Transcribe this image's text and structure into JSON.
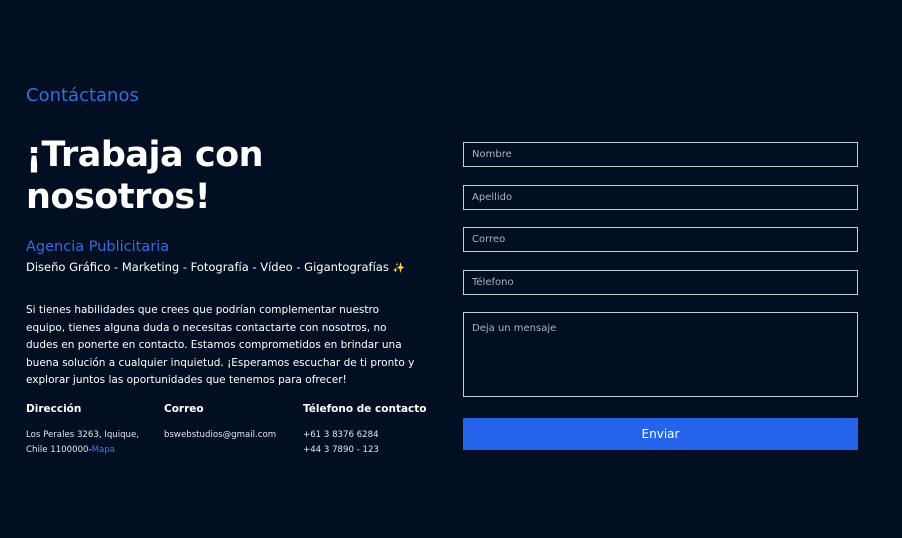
{
  "header": {
    "section_label": "Contáctanos",
    "headline": "¡Trabaja con nosotros!"
  },
  "agency": {
    "name": "Agencia Publicitaria",
    "services": "Diseño Gráfico - Marketing - Fotografía - Vídeo - Gigantografías",
    "services_icon": "sparkles-icon",
    "intro": "Si tienes habilidades que crees que podrían complementar nuestro equipo, tienes alguna duda o necesitas contactarte con nosotros, no dudes en ponerte en contacto. Estamos comprometidos en brindar una buena solución a cualquier inquietud. ¡Esperamos escuchar de ti pronto y explorar juntos las oportunidades que tenemos para ofrecer!"
  },
  "contact": {
    "address_title": "Dirección",
    "address_line1": "Los Perales 3263, Iquique,",
    "address_line2": "Chile 1100000-",
    "map_link": "Mapa",
    "email_title": "Correo",
    "email": "bswebstudios@gmail.com",
    "phone_title": "Télefono de contacto",
    "phone1": "+61 3 8376 6284",
    "phone2": "+44 3 7890 - 123"
  },
  "form": {
    "name_placeholder": "Nombre",
    "lastname_placeholder": "Apellido",
    "email_placeholder": "Correo",
    "phone_placeholder": "Télefono",
    "message_placeholder": "Deja un mensaje",
    "submit_label": "Enviar"
  },
  "colors": {
    "background": "#020f22",
    "accent": "#2f6fe0",
    "button": "#2563eb"
  }
}
